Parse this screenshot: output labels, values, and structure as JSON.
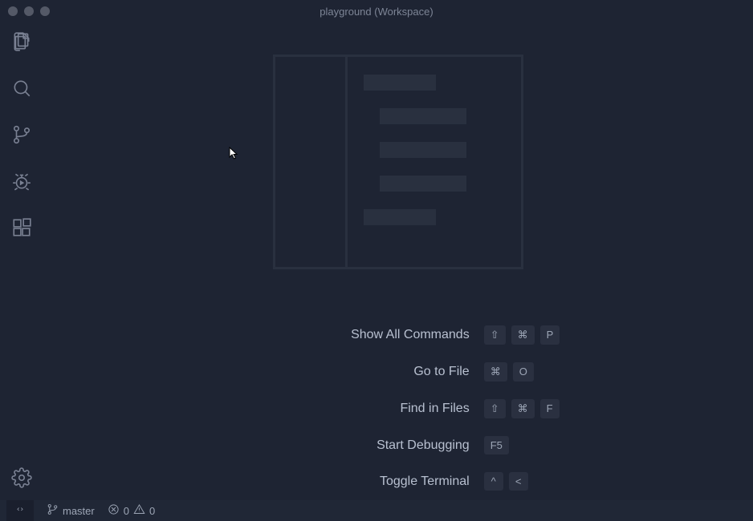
{
  "window": {
    "title": "playground (Workspace)"
  },
  "shortcuts": [
    {
      "label": "Show All Commands",
      "keys": [
        "⇧",
        "⌘",
        "P"
      ]
    },
    {
      "label": "Go to File",
      "keys": [
        "⌘",
        "O"
      ]
    },
    {
      "label": "Find in Files",
      "keys": [
        "⇧",
        "⌘",
        "F"
      ]
    },
    {
      "label": "Start Debugging",
      "keys": [
        "F5"
      ]
    },
    {
      "label": "Toggle Terminal",
      "keys": [
        "^",
        "<"
      ]
    }
  ],
  "status": {
    "branch": "master",
    "errors": "0",
    "warnings": "0"
  },
  "activity_bar": {
    "items": [
      "explorer",
      "search",
      "source-control",
      "debug",
      "extensions"
    ]
  }
}
